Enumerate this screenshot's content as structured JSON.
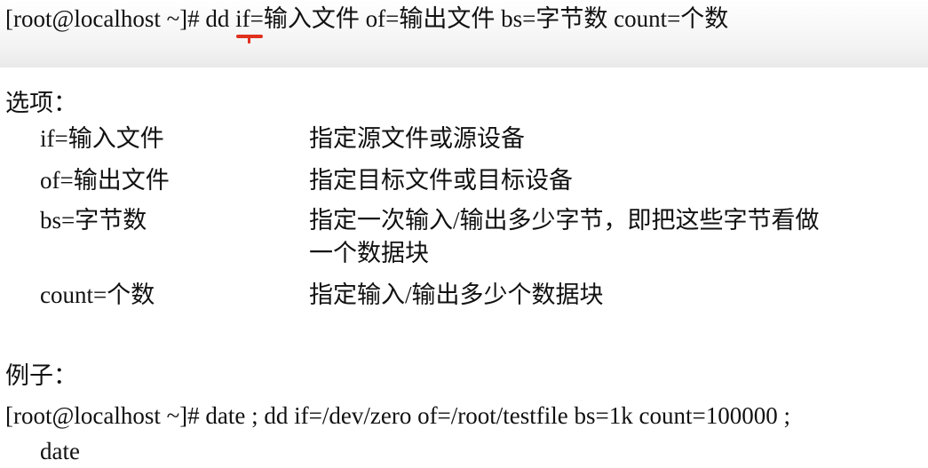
{
  "command": {
    "syntax": "[root@localhost ~]# dd if=输入文件 of=输出文件 bs=字节数 count=个数"
  },
  "options": {
    "heading": "选项：",
    "items": [
      {
        "name": "if=输入文件",
        "desc": "指定源文件或源设备"
      },
      {
        "name": "of=输出文件",
        "desc": "指定目标文件或目标设备"
      },
      {
        "name": "bs=字节数",
        "desc": "指定一次输入/输出多少字节，即把这些字节看做",
        "desc_cont": "一个数据块"
      },
      {
        "name": "count=个数",
        "desc": "指定输入/输出多少个数据块"
      }
    ]
  },
  "example": {
    "heading": "例子：",
    "line1": "[root@localhost ~]# date ; dd if=/dev/zero of=/root/testfile bs=1k count=100000 ;",
    "line2": "date"
  },
  "colors": {
    "annotation": "#e0301e"
  }
}
